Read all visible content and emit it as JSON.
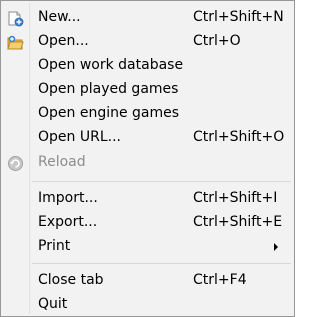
{
  "menu": {
    "items": [
      {
        "label": "New...",
        "shortcut": "Ctrl+Shift+N",
        "icon": "new-document-icon"
      },
      {
        "label": "Open...",
        "shortcut": "Ctrl+O",
        "icon": "open-folder-icon"
      },
      {
        "label": "Open work database",
        "shortcut": ""
      },
      {
        "label": "Open played games",
        "shortcut": ""
      },
      {
        "label": "Open engine games",
        "shortcut": ""
      },
      {
        "label": "Open URL...",
        "shortcut": "Ctrl+Shift+O"
      },
      {
        "label": "Reload",
        "shortcut": "",
        "icon": "reload-icon",
        "disabled": true
      },
      {
        "label": "Import...",
        "shortcut": "Ctrl+Shift+I"
      },
      {
        "label": "Export...",
        "shortcut": "Ctrl+Shift+E"
      },
      {
        "label": "Print",
        "shortcut": "",
        "submenu": true
      },
      {
        "label": "Close tab",
        "shortcut": "Ctrl+F4"
      },
      {
        "label": "Quit",
        "shortcut": ""
      }
    ]
  }
}
